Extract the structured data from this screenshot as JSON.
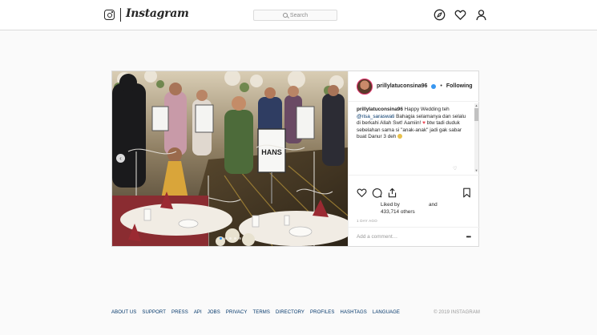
{
  "header": {
    "logo_text": "Instagram",
    "search_placeholder": "Search",
    "icons": [
      "instagram-glyph-icon",
      "compass-icon",
      "heart-icon",
      "user-icon"
    ]
  },
  "post": {
    "username": "prillylatuconsina96",
    "follow_status": "Following",
    "caption": {
      "username": "prillylatuconsina96",
      "text_1": " Happy Wedding teh ",
      "mention": "@risa_saraswati",
      "text_2": " Bahagia selamanya dan selalu di berkahi Allah Swt! Aamiin! ",
      "text_3": " btw tadi duduk sebelahan sama si \"anak-anak\" jadi gak sabar buat Danur 3 deh "
    },
    "liked_by_label": "Liked by",
    "likes_count": "433,714 others",
    "and_label": "and",
    "time_ago": "1 DAY AGO",
    "comment_placeholder": "Add a comment…",
    "more_label": "•••",
    "media": {
      "sign_text": "HANS",
      "carousel_dots": 5,
      "active_dot": 0
    }
  },
  "footer": {
    "links": [
      "ABOUT US",
      "SUPPORT",
      "PRESS",
      "API",
      "JOBS",
      "PRIVACY",
      "TERMS",
      "DIRECTORY",
      "PROFILES",
      "HASHTAGS",
      "LANGUAGE"
    ],
    "copyright": "© 2019 INSTAGRAM"
  },
  "colors": {
    "link_blue": "#003569",
    "verified_blue": "#3897f0",
    "border": "#dbdbdb",
    "background": "#fafafa"
  }
}
